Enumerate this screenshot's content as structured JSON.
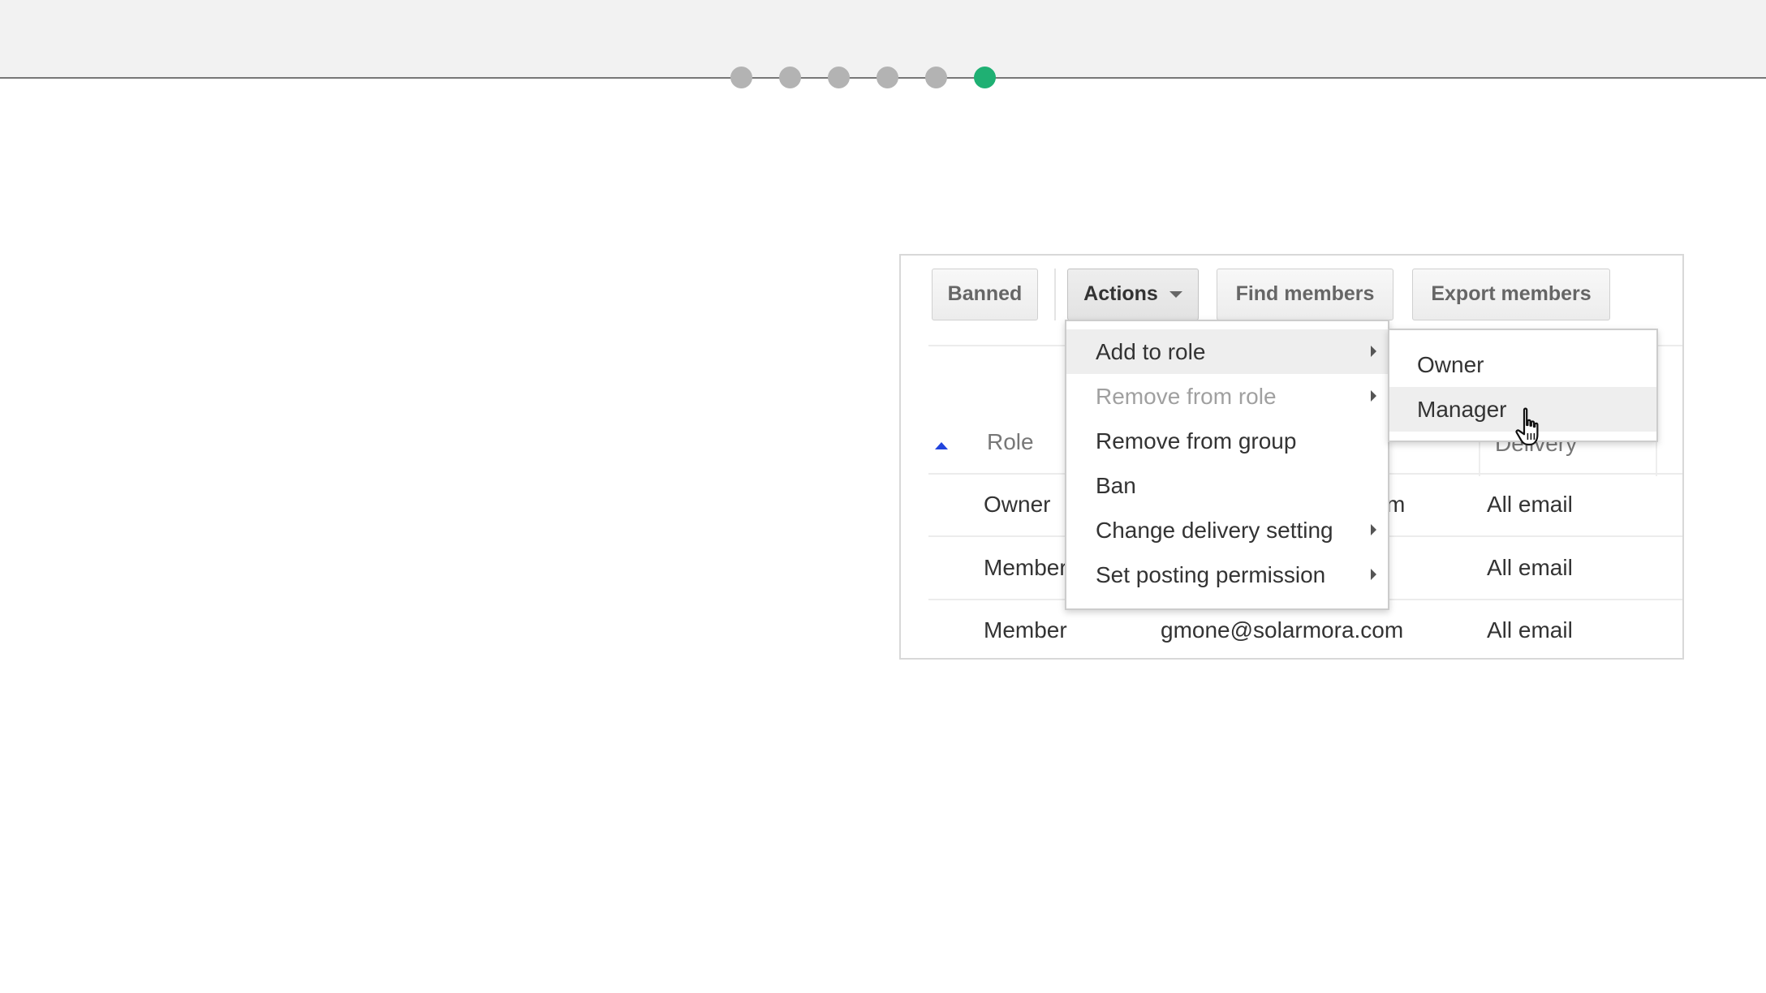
{
  "progress": {
    "total_steps": 6,
    "current_step": 6,
    "colors": {
      "inactive": "#b3b3b3",
      "active": "#1fb073"
    }
  },
  "toolbar": {
    "banned_label": "Banned",
    "actions_label": "Actions",
    "find_members_label": "Find members",
    "export_members_label": "Export members"
  },
  "table": {
    "headers": {
      "role": "Role",
      "delivery": "Delivery"
    },
    "rows": [
      {
        "role": "Owner",
        "email": "m",
        "delivery": "All email"
      },
      {
        "role": "Member",
        "email": "",
        "delivery": "All email"
      },
      {
        "role": "Member",
        "email": "gmone@solarmora.com",
        "delivery": "All email"
      }
    ]
  },
  "actions_menu": {
    "items": [
      {
        "label": "Add to role",
        "state": "hover",
        "has_submenu": true
      },
      {
        "label": "Remove from role",
        "state": "disabled",
        "has_submenu": true
      },
      {
        "label": "Remove from group",
        "state": "normal",
        "has_submenu": false
      },
      {
        "label": "Ban",
        "state": "normal",
        "has_submenu": false
      },
      {
        "label": "Change delivery setting",
        "state": "normal",
        "has_submenu": true
      },
      {
        "label": "Set posting permission",
        "state": "normal",
        "has_submenu": true
      }
    ]
  },
  "role_submenu": {
    "items": [
      {
        "label": "Owner",
        "state": "normal"
      },
      {
        "label": "Manager",
        "state": "hover"
      }
    ]
  },
  "cursor": {
    "icon": "hand-pointer-icon"
  }
}
